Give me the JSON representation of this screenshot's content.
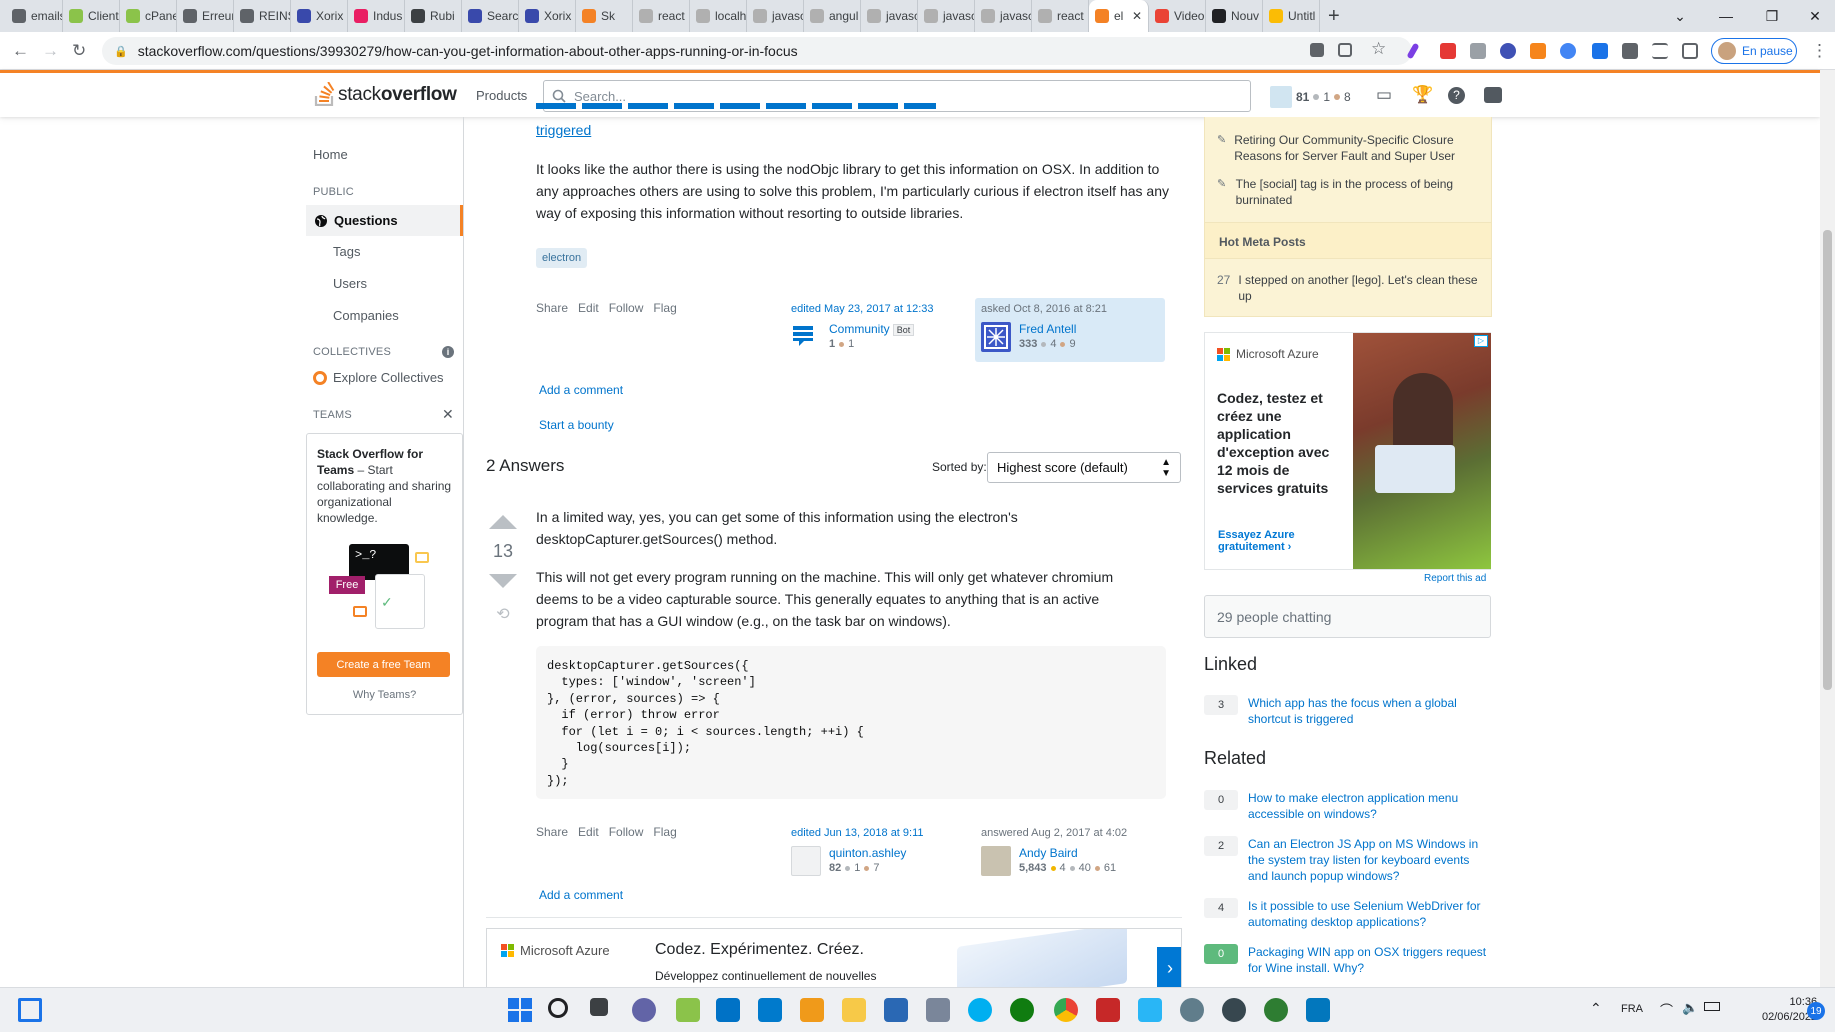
{
  "browser": {
    "tabs": [
      {
        "label": "emails",
        "color": "#5f6368"
      },
      {
        "label": "Client",
        "color": "#8bc34a"
      },
      {
        "label": "cPane",
        "color": "#8bc34a"
      },
      {
        "label": "Erreur",
        "color": "#5f6368"
      },
      {
        "label": "REINS",
        "color": "#5f6368"
      },
      {
        "label": "Xorix",
        "color": "#3949ab"
      },
      {
        "label": "Indus",
        "color": "#e91e63"
      },
      {
        "label": "Rubi",
        "color": "#3c4043"
      },
      {
        "label": "Searc",
        "color": "#3949ab"
      },
      {
        "label": "Xorix",
        "color": "#3949ab"
      },
      {
        "label": "Sk",
        "color": "#f48225"
      },
      {
        "label": "react",
        "color": "#b0b0b0"
      },
      {
        "label": "localh",
        "color": "#b0b0b0"
      },
      {
        "label": "javasc",
        "color": "#b0b0b0"
      },
      {
        "label": "angul",
        "color": "#b0b0b0"
      },
      {
        "label": "javasc",
        "color": "#b0b0b0"
      },
      {
        "label": "javasc",
        "color": "#b0b0b0"
      },
      {
        "label": "javasc",
        "color": "#b0b0b0"
      },
      {
        "label": "react",
        "color": "#b0b0b0"
      },
      {
        "label": "el",
        "color": "#f48225"
      },
      {
        "label": "Video",
        "color": "#ea4335"
      },
      {
        "label": "Nouv",
        "color": "#202124"
      },
      {
        "label": "Untitl",
        "color": "#fbbc05"
      }
    ],
    "url": "stackoverflow.com/questions/39930279/how-can-you-get-information-about-other-apps-running-or-in-focus",
    "profile_label": "En pause"
  },
  "so_header": {
    "logo_light": "stack",
    "logo_bold": "overflow",
    "products": "Products",
    "search_placeholder": "Search...",
    "rep": "81",
    "silver": "1",
    "bronze": "8"
  },
  "leftnav": {
    "home": "Home",
    "public": "PUBLIC",
    "questions": "Questions",
    "tags": "Tags",
    "users": "Users",
    "companies": "Companies",
    "collectives": "COLLECTIVES",
    "explore": "Explore Collectives",
    "teams": "TEAMS",
    "teams_card_title": "Stack Overflow for Teams",
    "teams_card_text": " – Start collaborating and sharing organizational knowledge.",
    "teams_free": "Free",
    "teams_btn": "Create a free Team",
    "why_teams": "Why Teams?"
  },
  "question": {
    "top_link": "triggered",
    "body": "It looks like the author there is using the nodObjc library to get this information on OSX. In addition to any approaches others are using to solve this problem, I'm particularly curious if electron itself has any way of exposing this information without resorting to outside libraries.",
    "tag": "electron",
    "menu": [
      "Share",
      "Edit",
      "Follow",
      "Flag"
    ],
    "edited": "edited May 23, 2017 at 12:33",
    "editor_name": "Community",
    "editor_badge": "Bot",
    "editor_rep": "1",
    "editor_bronze": "1",
    "asked": "asked Oct 8, 2016 at 8:21",
    "asker_name": "Fred Antell",
    "asker_rep": "333",
    "asker_silver": "4",
    "asker_bronze": "9",
    "add_comment": "Add a comment",
    "bounty": "Start a bounty"
  },
  "answers": {
    "heading": "2 Answers",
    "sorted_by": "Sorted by:",
    "sort_value": "Highest score (default)"
  },
  "answer1": {
    "score": "13",
    "p1": "In a limited way, yes, you can get some of this information using the electron's desktopCapturer.getSources() method.",
    "p2": "This will not get every program running on the machine. This will only get whatever chromium deems to be a video capturable source. This generally equates to anything that is an active program that has a GUI window (e.g., on the task bar on windows).",
    "code": "desktopCapturer.getSources({\n  types: ['window', 'screen']\n}, (error, sources) => {\n  if (error) throw error\n  for (let i = 0; i < sources.length; ++i) {\n    log(sources[i]);\n  }\n});",
    "menu": [
      "Share",
      "Edit",
      "Follow",
      "Flag"
    ],
    "edited": "edited Jun 13, 2018 at 9:11",
    "editor_name": "quinton.ashley",
    "editor_rep": "82",
    "editor_silver": "1",
    "editor_bronze": "7",
    "answered": "answered Aug 2, 2017 at 4:02",
    "author_name": "Andy Baird",
    "author_rep": "5,843",
    "author_gold": "4",
    "author_silver": "40",
    "author_bronze": "61",
    "add_comment": "Add a comment"
  },
  "right": {
    "meta1": "Retiring Our Community-Specific Closure Reasons for Server Fault and Super User",
    "meta2": "The [social] tag is in the process of being burninated",
    "hot_meta": "Hot Meta Posts",
    "hot1_score": "27",
    "hot1": "I stepped on another [lego]. Let's clean these up",
    "ad_brand": "Microsoft Azure",
    "ad_text": "Codez, testez et créez une application d'exception avec 12 mois de services gratuits",
    "ad_cta": "Essayez Azure gratuitement ›",
    "report_ad": "Report this ad",
    "chat": "29 people chatting",
    "linked_h": "Linked",
    "linked": [
      {
        "score": "3",
        "title": "Which app has the focus when a global shortcut is triggered"
      }
    ],
    "related_h": "Related",
    "related": [
      {
        "score": "0",
        "title": "How to make electron application menu accessible on windows?",
        "accepted": false
      },
      {
        "score": "2",
        "title": "Can an Electron JS App on MS Windows in the system tray listen for keyboard events and launch popup windows?",
        "accepted": false
      },
      {
        "score": "4",
        "title": "Is it possible to use Selenium WebDriver for automating desktop applications?",
        "accepted": false
      },
      {
        "score": "0",
        "title": "Packaging WIN app on OSX triggers request for Wine install. Why?",
        "accepted": true
      }
    ]
  },
  "bottom_ad": {
    "brand": "Microsoft Azure",
    "headline": "Codez. Expérimentez. Créez.",
    "sub": "Développez continuellement de nouvelles"
  },
  "taskbar": {
    "lang": "FRA",
    "time": "10:36",
    "date": "02/06/2022",
    "notifications": "19"
  }
}
